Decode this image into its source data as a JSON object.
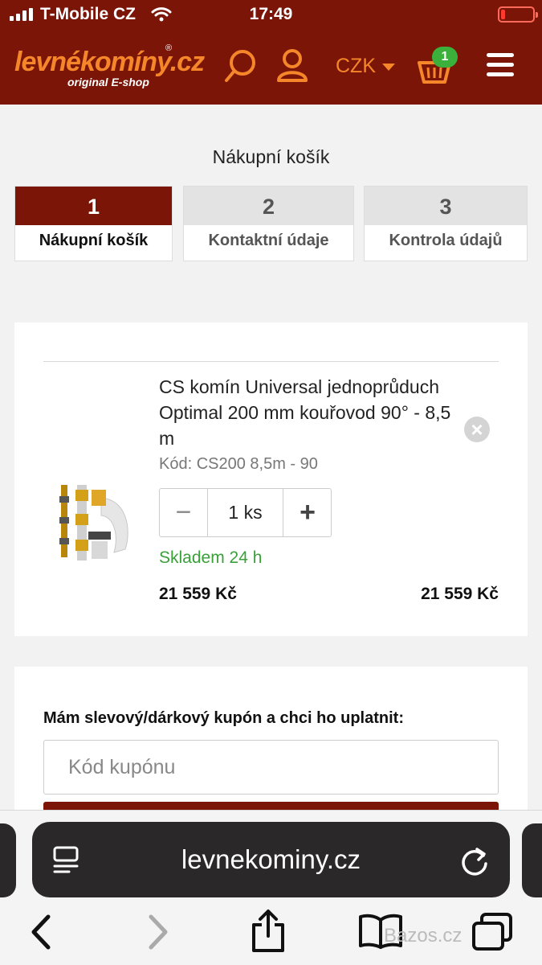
{
  "status_bar": {
    "carrier": "T-Mobile CZ",
    "time": "17:49"
  },
  "header": {
    "logo_brand": "levnékomíny.cz",
    "logo_tagline": "original E-shop",
    "logo_registered": "®",
    "currency": "CZK",
    "cart_count": "1",
    "icons": [
      "search-icon",
      "user-icon",
      "chevron-down-icon",
      "basket-icon",
      "menu-icon"
    ]
  },
  "page_title": "Nákupní košík",
  "steps": [
    {
      "number": "1",
      "label": "Nákupní košík",
      "active": true
    },
    {
      "number": "2",
      "label": "Kontaktní údaje",
      "active": false
    },
    {
      "number": "3",
      "label": "Kontrola údajů",
      "active": false
    }
  ],
  "cart_item": {
    "name": "CS komín Universal jednoprůduch Optimal 200 mm kouřovod 90° - 8,5 m",
    "code": "Kód: CS200 8,5m - 90",
    "quantity": "1 ks",
    "availability": "Skladem 24 h",
    "unit_price": "21 559 Kč",
    "total_price": "21 559 Kč",
    "remove_icon": "×",
    "minus": "−",
    "plus": "+"
  },
  "coupon": {
    "label": "Mám slevový/dárkový kupón a chci ho uplatnit:",
    "placeholder": "Kód kupónu"
  },
  "browser": {
    "url": "levnekominy.cz",
    "icons": [
      "reader-icon",
      "reload-icon",
      "back-icon",
      "forward-icon",
      "share-icon",
      "bookmarks-icon",
      "tabs-icon"
    ]
  },
  "watermark": "Bazos.cz",
  "colors": {
    "brand_dark": "#7a1508",
    "brand_orange": "#f5862a",
    "badge_green": "#3bb03b",
    "stock_green": "#3aa03a"
  }
}
